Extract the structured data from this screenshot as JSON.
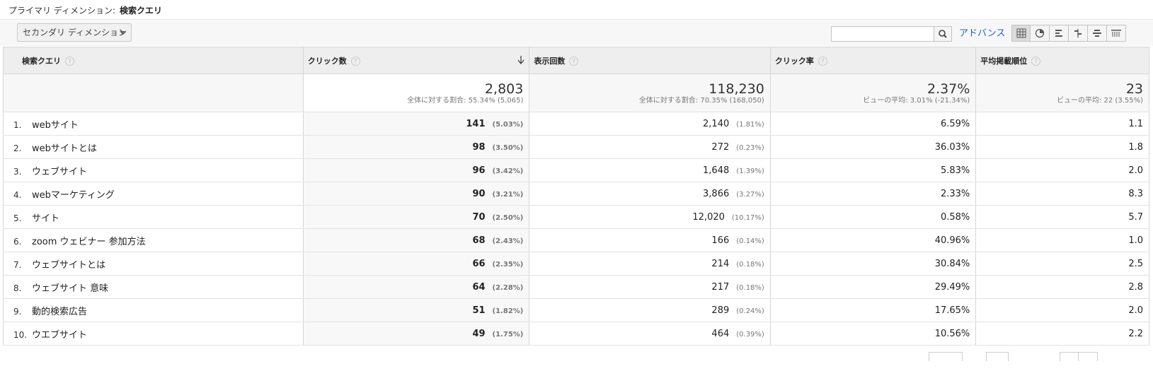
{
  "primary_dimension": {
    "label": "プライマリ ディメンション:",
    "value": "検索クエリ"
  },
  "secondary_dimension_button": "セカンダリ ディメンション",
  "search": {
    "value": "",
    "placeholder": ""
  },
  "advanced_link": "アドバンス",
  "view_icons": [
    "table-view-icon",
    "pie-view-icon",
    "bar-view-icon",
    "comparison-view-icon",
    "term-cloud-icon",
    "pivot-view-icon"
  ],
  "columns": {
    "query": "検索クエリ",
    "clicks": "クリック数",
    "impressions": "表示回数",
    "ctr": "クリック率",
    "position": "平均掲載順位"
  },
  "totals": {
    "clicks": "2,803",
    "clicks_sub": "全体に対する割合: 55.34% (5,065)",
    "impressions": "118,230",
    "impressions_sub": "全体に対する割合: 70.35% (168,050)",
    "ctr": "2.37%",
    "ctr_sub": "ビューの平均: 3.01% (-21.34%)",
    "position": "23",
    "position_sub": "ビューの平均: 22 (3.55%)"
  },
  "rows": [
    {
      "idx": "1.",
      "query": "webサイト",
      "clicks": "141",
      "clicks_pct": "(5.03%)",
      "impr": "2,140",
      "impr_pct": "(1.81%)",
      "ctr": "6.59%",
      "pos": "1.1"
    },
    {
      "idx": "2.",
      "query": "webサイトとは",
      "clicks": "98",
      "clicks_pct": "(3.50%)",
      "impr": "272",
      "impr_pct": "(0.23%)",
      "ctr": "36.03%",
      "pos": "1.8"
    },
    {
      "idx": "3.",
      "query": "ウェブサイト",
      "clicks": "96",
      "clicks_pct": "(3.42%)",
      "impr": "1,648",
      "impr_pct": "(1.39%)",
      "ctr": "5.83%",
      "pos": "2.0"
    },
    {
      "idx": "4.",
      "query": "webマーケティング",
      "clicks": "90",
      "clicks_pct": "(3.21%)",
      "impr": "3,866",
      "impr_pct": "(3.27%)",
      "ctr": "2.33%",
      "pos": "8.3"
    },
    {
      "idx": "5.",
      "query": "サイト",
      "clicks": "70",
      "clicks_pct": "(2.50%)",
      "impr": "12,020",
      "impr_pct": "(10.17%)",
      "ctr": "0.58%",
      "pos": "5.7"
    },
    {
      "idx": "6.",
      "query": "zoom ウェビナー 参加方法",
      "clicks": "68",
      "clicks_pct": "(2.43%)",
      "impr": "166",
      "impr_pct": "(0.14%)",
      "ctr": "40.96%",
      "pos": "1.0"
    },
    {
      "idx": "7.",
      "query": "ウェブサイトとは",
      "clicks": "66",
      "clicks_pct": "(2.35%)",
      "impr": "214",
      "impr_pct": "(0.18%)",
      "ctr": "30.84%",
      "pos": "2.5"
    },
    {
      "idx": "8.",
      "query": "ウェブサイト 意味",
      "clicks": "64",
      "clicks_pct": "(2.28%)",
      "impr": "217",
      "impr_pct": "(0.18%)",
      "ctr": "29.49%",
      "pos": "2.8"
    },
    {
      "idx": "9.",
      "query": "動的検索広告",
      "clicks": "51",
      "clicks_pct": "(1.82%)",
      "impr": "289",
      "impr_pct": "(0.24%)",
      "ctr": "17.65%",
      "pos": "2.0"
    },
    {
      "idx": "10.",
      "query": "ウエブサイト",
      "clicks": "49",
      "clicks_pct": "(1.75%)",
      "impr": "464",
      "impr_pct": "(0.39%)",
      "ctr": "10.56%",
      "pos": "2.2"
    }
  ]
}
